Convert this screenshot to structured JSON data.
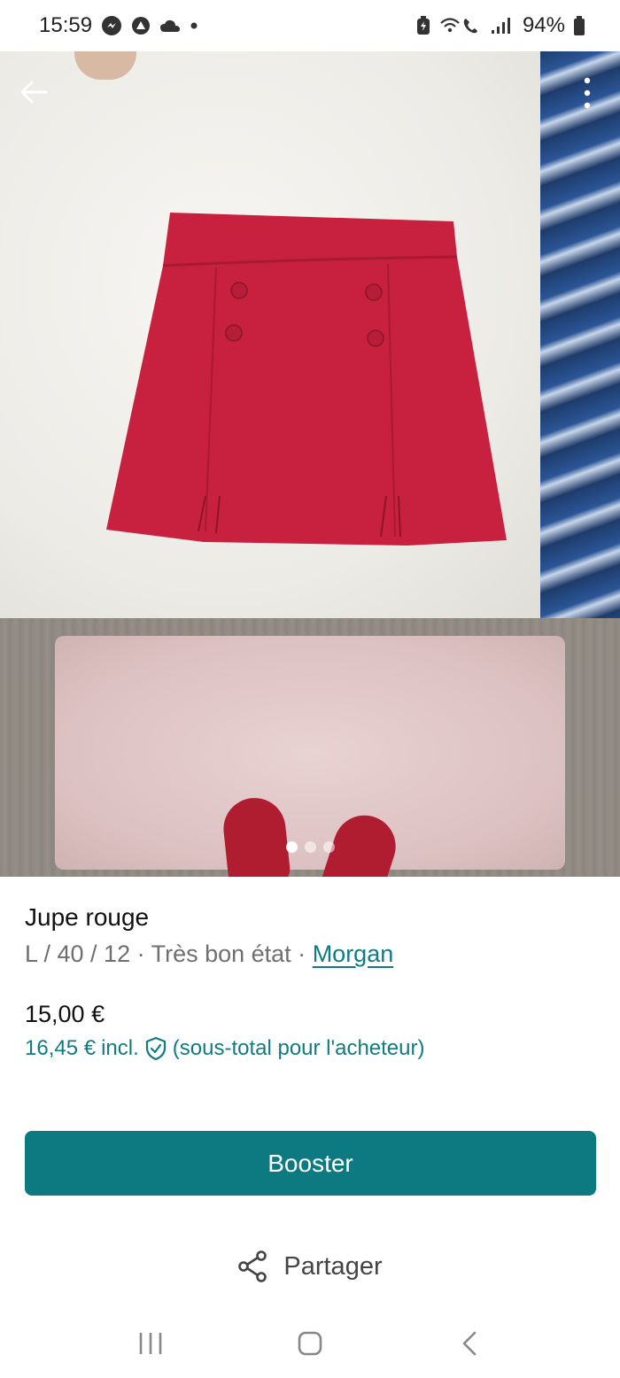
{
  "status_bar": {
    "time": "15:59",
    "battery": "94%",
    "left_icons": [
      "messenger-icon",
      "vpn-icon",
      "cloud-icon",
      "dot-icon"
    ],
    "right_icons": [
      "battery-saver-icon",
      "wifi-call-icon",
      "signal-icon",
      "battery-icon"
    ]
  },
  "photo": {
    "slide_count": 3,
    "active_slide": 0
  },
  "item": {
    "title": "Jupe rouge",
    "details": "L / 40 / 12 · Très bon état · ",
    "brand": "Morgan",
    "price": "15,00 €",
    "price_incl_amount": "16,45 €",
    "price_incl_word": "incl.",
    "price_incl_note": "(sous-total pour l'acheteur)"
  },
  "actions": {
    "boost_label": "Booster",
    "share_label": "Partager"
  },
  "colors": {
    "accent": "#0d7a82",
    "link": "#0f7b82",
    "skirt": "#c8213f"
  }
}
